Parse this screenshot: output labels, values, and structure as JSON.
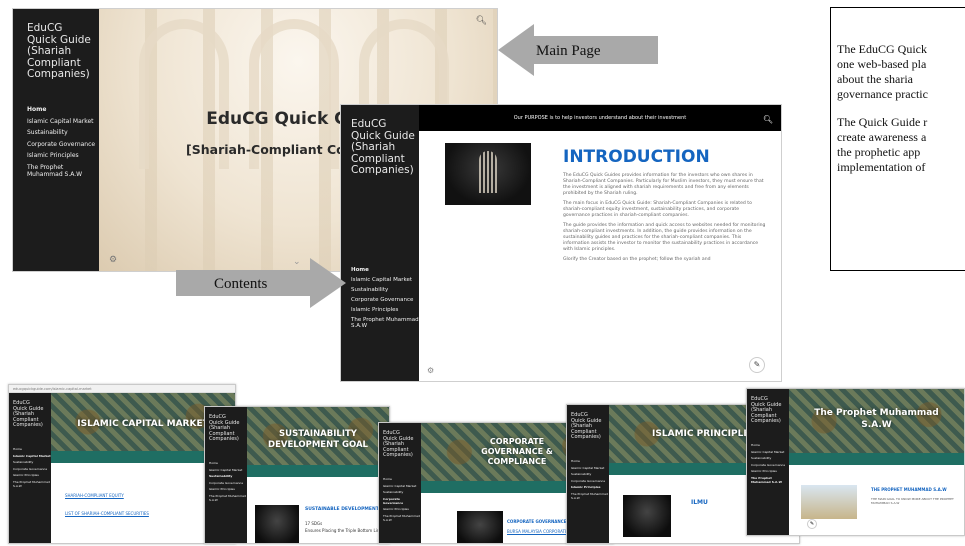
{
  "site": {
    "title": "EduCG Quick Guide (Shariah Compliant Companies)",
    "title_lines": [
      "EduCG",
      "Quick Guide",
      "(Shariah",
      "Compliant",
      "Companies)"
    ],
    "nav": [
      "Home",
      "Islamic Capital Market",
      "Sustainability",
      "Corporate Governance",
      "Islamic Principles",
      "The Prophet Muhammad S.A.W"
    ]
  },
  "main_page": {
    "hero_title": "EduCG Quick Guide",
    "hero_subtitle": "[Shariah-Compliant Companies]",
    "active_nav": "Home"
  },
  "annotations": {
    "main_page_label": "Main Page",
    "contents_label": "Contents",
    "arrow_color": "#a9a9a9"
  },
  "content_page": {
    "purpose": "Our PURPOSE is to help investors understand about their investment",
    "heading": "INTRODUCTION",
    "paragraphs": [
      "The EduCG Quick Guides provides information for the investors who own shares in Shariah-Compliant Companies. Particularly for Muslim investors, they must ensure that the investment is aligned with shariah requirements and free from any elements prohibited by the Shariah ruling.",
      "The main focus in EduCG Quick Guide: Shariah-Compliant Companies is related to shariah-compliant equity investment, sustainability practices, and corporate governance practices in shariah-compliant companies.",
      "The guide provides the information and quick access to websites needed for monitoring shariah-compliant investments. In addition, the guide provides information on the sustainability guides and practices for the shariah-compliant companies. This information assists the investor to monitor the sustainability practices in accordance with Islamic principles.",
      "Glorify the Creator based on the prophet; follow the syariah and"
    ]
  },
  "description": {
    "lines": [
      "The EduCG Quick",
      "one web-based pla",
      "about the sharia",
      "governance practic",
      "The Quick Guide r",
      "create awareness a",
      "the prophetic app",
      "implementation of"
    ]
  },
  "bottom_pages": [
    {
      "banner": "ISLAMIC CAPITAL MARKET",
      "link1": "SHARIAH-COMPLIANT EQUITY",
      "link2": "LIST OF SHARIAH-COMPLIANT SECURITIES",
      "browser_url": "educgquickguide.com/islamic-capital-market"
    },
    {
      "banner_lines": [
        "SUSTAINABILITY",
        "DEVELOPMENT GOAL"
      ],
      "section": "SUSTAINABLE DEVELOPMENT",
      "sub1": "17 SDGs",
      "sub2": "Ensures Placing the Triple Bottom Line"
    },
    {
      "banner_lines": [
        "CORPORATE",
        "GOVERNANCE &",
        "COMPLIANCE"
      ],
      "section": "CORPORATE GOVERNANCE REG",
      "sub1": "BURSA MALAYSIA CORPORATE GOVERNANCE"
    },
    {
      "banner": "ISLAMIC PRINCIPLES",
      "section": "ILMU"
    },
    {
      "banner_lines": [
        "The Prophet Muhammad",
        "S.A.W"
      ],
      "section": "THE PROPHET MUHAMMAD S.A.W",
      "sub1": "THE MAIN GOAL TO KNOW MORE ABOUT THE PROPHET MUHAMMAD S.A.W"
    }
  ],
  "icons": [
    "search-icon",
    "gear-icon",
    "chevron-down-icon",
    "pencil-icon"
  ]
}
